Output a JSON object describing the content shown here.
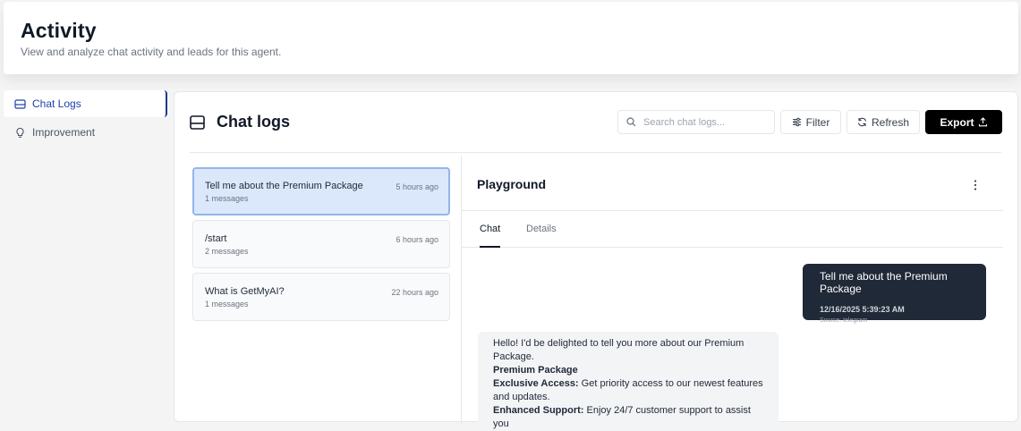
{
  "header": {
    "title": "Activity",
    "subtitle": "View and analyze chat activity and leads for this agent."
  },
  "sidebar": {
    "items": [
      {
        "label": "Chat Logs",
        "icon": "inbox-icon",
        "active": true
      },
      {
        "label": "Improvement",
        "icon": "lightbulb-icon",
        "active": false
      }
    ]
  },
  "main": {
    "title": "Chat logs",
    "search_placeholder": "Search chat logs...",
    "filter_label": "Filter",
    "refresh_label": "Refresh",
    "export_label": "Export"
  },
  "conversations": [
    {
      "title": "Tell me about the Premium Package",
      "meta": "1 messages",
      "time": "5 hours ago",
      "selected": true
    },
    {
      "title": "/start",
      "meta": "2 messages",
      "time": "6 hours ago",
      "selected": false
    },
    {
      "title": "What is GetMyAI?",
      "meta": "1 messages",
      "time": "22 hours ago",
      "selected": false
    }
  ],
  "playground": {
    "title": "Playground",
    "tabs": [
      "Chat",
      "Details"
    ],
    "user_message": {
      "text": "Tell me about the Premium Package",
      "timestamp": "12/16/2025 5:39:23 AM",
      "source": "Source: telegram"
    },
    "bot_message": {
      "intro": "Hello! I'd be delighted to tell you more about our Premium Package.",
      "heading": "Premium Package",
      "b1_label": "Exclusive Access:",
      "b1_text": " Get priority access to our newest features and updates.",
      "b2_label": "Enhanced Support:",
      "b2_text": " Enjoy 24/7 customer support to assist you"
    }
  },
  "colors": {
    "accent": "#1e40af",
    "selected_bg": "#dbe8fb",
    "user_bubble": "#1f2937",
    "export_bg": "#000000"
  }
}
